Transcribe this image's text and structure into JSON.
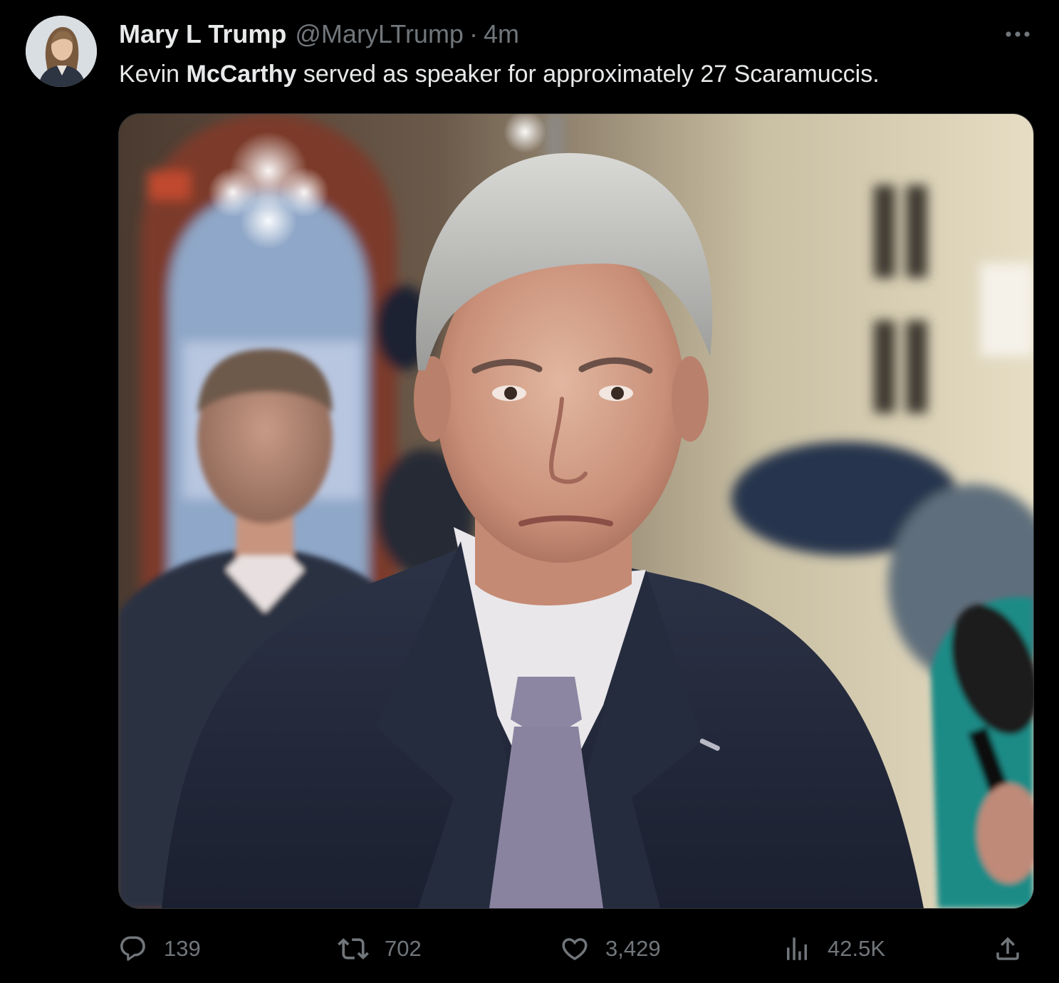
{
  "tweet": {
    "author_name": "Mary L Trump",
    "handle": "@MaryLTrump",
    "separator": "·",
    "time": "4m",
    "text_pre": "Kevin ",
    "text_bold": "McCarthy",
    "text_post": " served as speaker for approximately 27 Scaramuccis."
  },
  "actions": {
    "replies": "139",
    "reposts": "702",
    "likes": "3,429",
    "views": "42.5K"
  },
  "icons": {
    "reply": "reply-icon",
    "repost": "repost-icon",
    "like": "heart-icon",
    "views": "views-icon",
    "share": "share-icon",
    "more": "more-icon"
  },
  "colors": {
    "background": "#000000",
    "text": "#e7e9ea",
    "muted": "#71767b",
    "border": "#2f3336"
  }
}
